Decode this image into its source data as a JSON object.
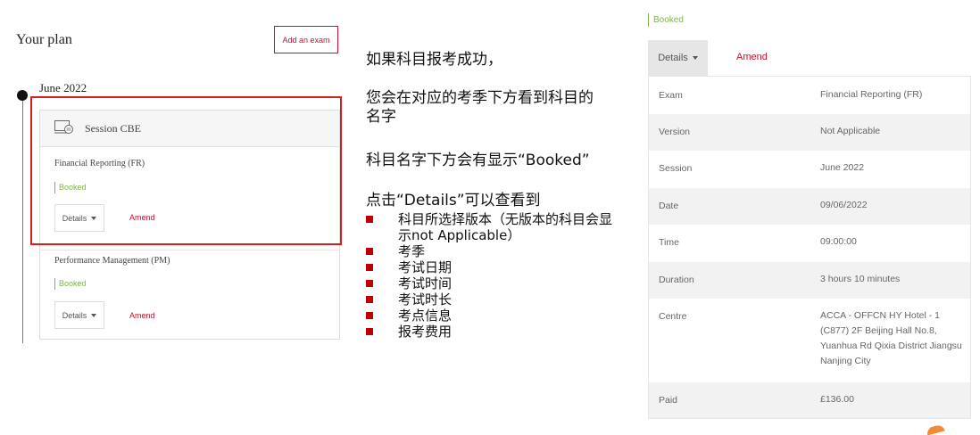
{
  "plan": {
    "title": "Your plan",
    "add_exam_label": "Add an exam",
    "season": "June 2022",
    "session_label": "Session CBE",
    "exams": [
      {
        "name": "Financial Reporting (FR)",
        "status": "Booked",
        "details_label": "Details",
        "amend_label": "Amend"
      },
      {
        "name": "Performance Management (PM)",
        "status": "Booked",
        "details_label": "Details",
        "amend_label": "Amend"
      }
    ]
  },
  "annotation": {
    "line1": "如果科目报考成功，",
    "line2a": "您会在对应的考季下方看到科目的",
    "line2b": "名字",
    "line3": "科目名字下方会有显示“Booked”",
    "line4": "点击“Details”可以查看到",
    "bullets": [
      "科目所选择版本（无版本的科目会显示not Applicable）",
      "考季",
      "考试日期",
      "考试时间",
      "考试时长",
      "考点信息",
      "报考费用"
    ]
  },
  "details": {
    "status": "Booked",
    "details_label": "Details",
    "amend_label": "Amend",
    "rows": [
      {
        "label": "Exam",
        "value": "Financial Reporting (FR)"
      },
      {
        "label": "Version",
        "value": "Not Applicable"
      },
      {
        "label": "Session",
        "value": "June 2022"
      },
      {
        "label": "Date",
        "value": "09/06/2022"
      },
      {
        "label": "Time",
        "value": "09:00:00"
      },
      {
        "label": "Duration",
        "value": "3 hours 10 minutes"
      },
      {
        "label": "Centre",
        "value": "ACCA - OFFCN HY Hotel - 1 (C877) 2F Beijing Hall No.8, Yuanhua Rd Qixia District Jiangsu Nanjing City"
      },
      {
        "label": "Paid",
        "value": "£136.00"
      }
    ]
  },
  "colors": {
    "accent_red": "#c8102e",
    "booked_green": "#7ab648",
    "highlight_red": "#d62020",
    "bullet_red": "#c00000"
  },
  "icons": [
    "session-cbe-icon",
    "dropdown-caret-icon",
    "timeline-dot-icon"
  ]
}
